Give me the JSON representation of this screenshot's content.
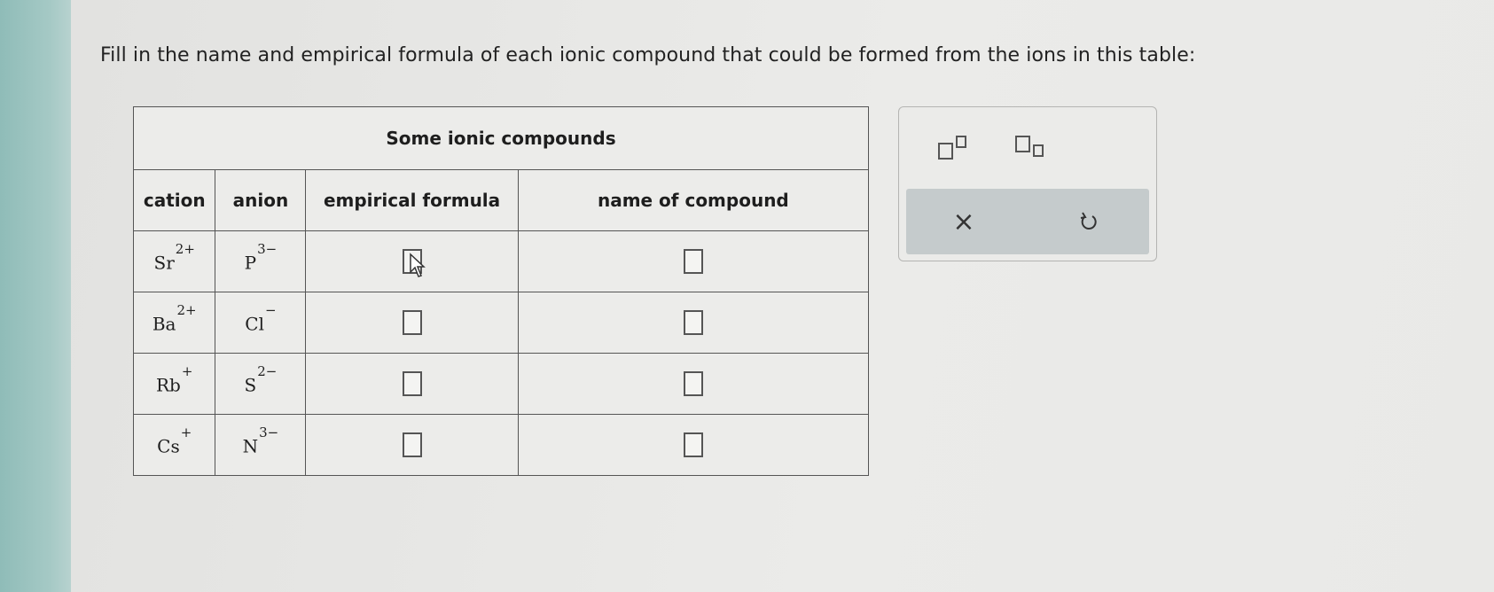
{
  "prompt": "Fill in the name and empirical formula of each ionic compound that could be formed from the ions in this table:",
  "table": {
    "title": "Some ionic compounds",
    "headers": [
      "cation",
      "anion",
      "empirical formula",
      "name of compound"
    ],
    "rows": [
      {
        "cation": "Sr",
        "cation_charge": "2+",
        "anion": "P",
        "anion_charge": "3−",
        "formula": "",
        "name": ""
      },
      {
        "cation": "Ba",
        "cation_charge": "2+",
        "anion": "Cl",
        "anion_charge": "−",
        "formula": "",
        "name": ""
      },
      {
        "cation": "Rb",
        "cation_charge": "+",
        "anion": "S",
        "anion_charge": "2−",
        "formula": "",
        "name": ""
      },
      {
        "cation": "Cs",
        "cation_charge": "+",
        "anion": "N",
        "anion_charge": "3−",
        "formula": "",
        "name": ""
      }
    ]
  },
  "tools": {
    "superscript_icon": "superscript-icon",
    "subscript_icon": "subscript-icon",
    "clear_icon": "close-icon",
    "undo_icon": "undo-icon",
    "clear_glyph": "×"
  },
  "colors": {
    "background": "#e7e7e5",
    "accent_strip": "#a5c9c5",
    "action_bar": "#c5cbcc",
    "border": "#555555"
  }
}
